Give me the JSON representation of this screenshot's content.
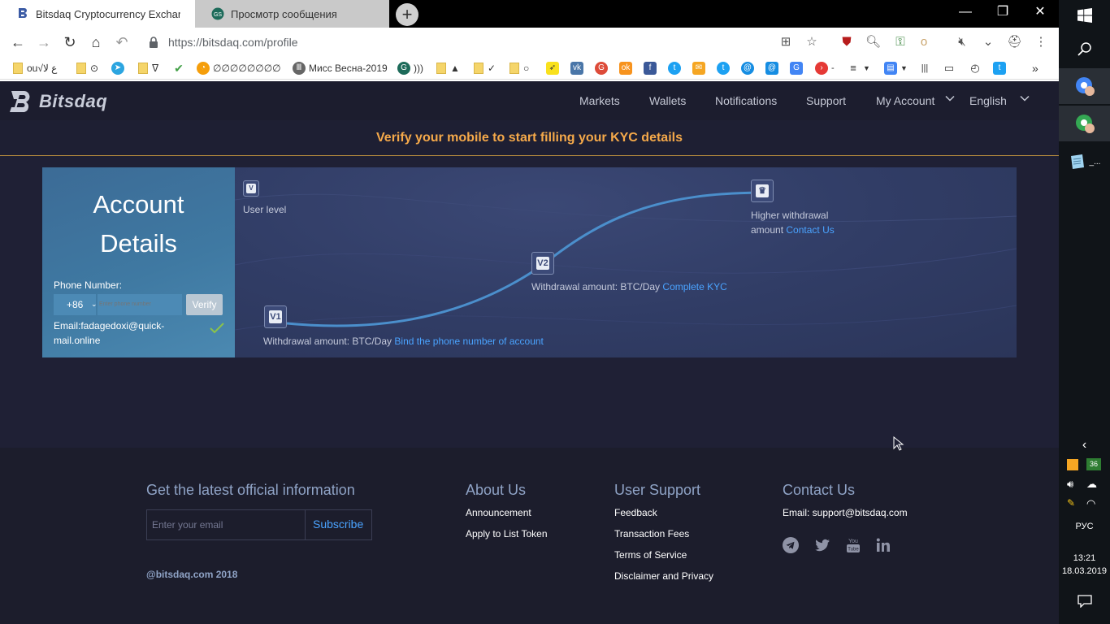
{
  "browser": {
    "tabs": [
      {
        "title": "Bitsdaq Cryptocurrency Exchange",
        "active": true
      },
      {
        "title": "Просмотр сообщения",
        "active": false
      }
    ],
    "new_tab": "+",
    "address": "https://bitsdaq.com/profile",
    "window_controls": {
      "minimize": "—",
      "restore": "❐",
      "close": "✕"
    },
    "bookmarks": [
      {
        "label": "ou√ع لا",
        "icon": "folder"
      },
      {
        "label": "⊙",
        "icon": "folder"
      },
      {
        "label": "",
        "icon": "telegram-icon"
      },
      {
        "label": "ᐁ",
        "icon": "folder"
      },
      {
        "label": "",
        "icon": "check-icon"
      },
      {
        "label": "∅∅∅∅∅∅∅∅",
        "icon": "orange-bubble-icon"
      },
      {
        "label": "Мисс Весна-2019",
        "icon": "museum-icon"
      },
      {
        "label": ")))",
        "icon": "green-circle-icon"
      },
      {
        "label": "▲",
        "icon": "folder"
      },
      {
        "label": "✓",
        "icon": "folder"
      },
      {
        "label": "○",
        "icon": "folder"
      }
    ]
  },
  "site": {
    "logo": "Bitsdaq",
    "nav": {
      "markets": "Markets",
      "wallets": "Wallets",
      "notifications": "Notifications",
      "support": "Support",
      "account": "My Account",
      "language": "English"
    },
    "banner": "Verify your mobile to start filling your KYC details"
  },
  "account": {
    "title_line1": "Account",
    "title_line2": "Details",
    "phone_label": "Phone Number:",
    "country_code": "+86",
    "phone_placeholder": "Enter phone number",
    "verify_label": "Verify",
    "email": "Email:fadagedoxi@quick-mail.online"
  },
  "levels": {
    "user_level": "User level",
    "level1": {
      "text": "Withdrawal amount: BTC/Day",
      "link": "Bind the phone number of account"
    },
    "level2": {
      "text": "Withdrawal amount: BTC/Day",
      "link": "Complete KYC"
    },
    "level3": {
      "line1": "Higher withdrawal",
      "line2": "amount",
      "link": "Contact Us"
    }
  },
  "footer": {
    "newsletter_title": "Get the latest official information",
    "email_placeholder": "Enter your email",
    "subscribe": "Subscribe",
    "copyright": "@bitsdaq.com 2018",
    "about": {
      "title": "About Us",
      "links": [
        "Announcement",
        "Apply to List Token"
      ]
    },
    "support": {
      "title": "User Support",
      "links": [
        "Feedback",
        "Transaction Fees",
        "Terms of Service",
        "Disclaimer and Privacy"
      ]
    },
    "contact": {
      "title": "Contact Us",
      "email": "Email: support@bitsdaq.com"
    }
  },
  "taskbar": {
    "badge": "36",
    "language": "РУС",
    "time": "13:21",
    "date": "18.03.2019",
    "running_label": "_..."
  },
  "colors": {
    "accent_orange": "#f5a94a",
    "link_blue": "#4aa3ff",
    "page_bg": "#1f2035"
  }
}
